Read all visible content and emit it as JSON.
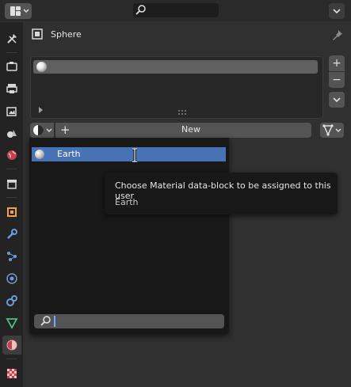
{
  "header": {
    "editor_type_icon": "properties-editor-icon",
    "search_placeholder": "",
    "menu_icon": "chevron-down-icon"
  },
  "tabs": [
    {
      "name": "tool",
      "icon": "wrench-screwdriver-icon"
    },
    {
      "name": "render",
      "icon": "camera-back-icon"
    },
    {
      "name": "output",
      "icon": "printer-icon"
    },
    {
      "name": "view-layer",
      "icon": "image-stack-icon"
    },
    {
      "name": "scene",
      "icon": "scene-cone-sphere-icon"
    },
    {
      "name": "world",
      "icon": "world-globe-icon"
    },
    {
      "name": "collection",
      "icon": "box-icon"
    },
    {
      "name": "object",
      "icon": "object-square-icon"
    },
    {
      "name": "modifiers",
      "icon": "wrench-icon"
    },
    {
      "name": "particles",
      "icon": "particles-icon"
    },
    {
      "name": "physics",
      "icon": "physics-orbit-icon"
    },
    {
      "name": "constraints",
      "icon": "constraint-icon"
    },
    {
      "name": "data",
      "icon": "mesh-triangle-icon"
    },
    {
      "name": "material",
      "icon": "material-sphere-icon",
      "active": true
    },
    {
      "name": "texture",
      "icon": "checker-icon"
    }
  ],
  "properties": {
    "object_name": "Sphere",
    "new_label": "New",
    "add_slot_label": "+",
    "remove_slot_label": "−",
    "add_material_label": "+"
  },
  "dropdown": {
    "items": [
      {
        "label": "Earth",
        "selected": true
      }
    ],
    "search_value": ""
  },
  "tooltip": {
    "title": "Choose Material data-block to be assigned to this user",
    "subtitle": "Earth"
  },
  "colors": {
    "selection": "#4772b3",
    "background": "#303030",
    "tab_column": "#232323",
    "button": "#545454",
    "popup": "#181818"
  }
}
